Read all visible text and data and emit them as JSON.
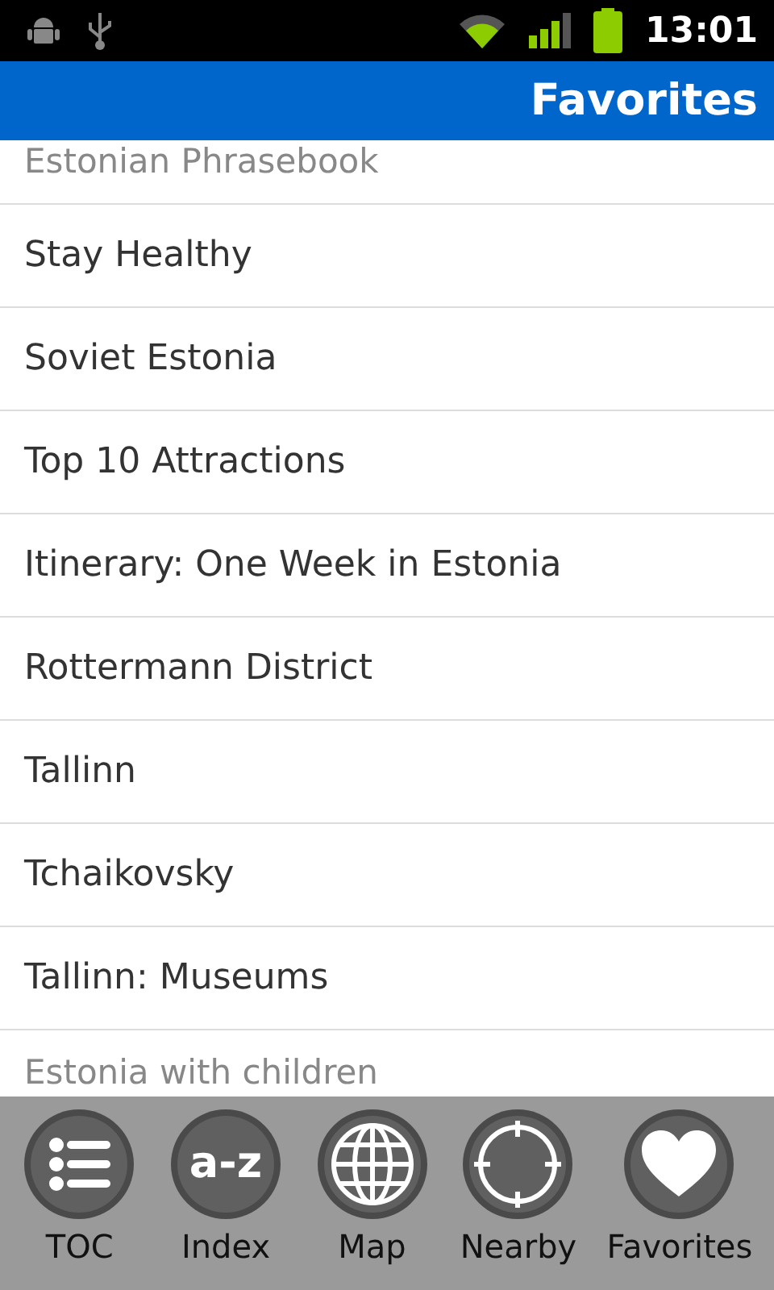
{
  "status_bar": {
    "time": "13:01"
  },
  "title": "Favorites",
  "rows": [
    {
      "label": "Estonian Phrasebook",
      "kind": "cut-top"
    },
    {
      "label": "Stay Healthy",
      "kind": "full"
    },
    {
      "label": "Soviet Estonia",
      "kind": "full"
    },
    {
      "label": "Top 10 Attractions",
      "kind": "full"
    },
    {
      "label": "Itinerary: One Week in Estonia",
      "kind": "full"
    },
    {
      "label": "Rottermann District",
      "kind": "full"
    },
    {
      "label": "Tallinn",
      "kind": "full"
    },
    {
      "label": "Tchaikovsky",
      "kind": "full"
    },
    {
      "label": "Tallinn: Museums",
      "kind": "full"
    },
    {
      "label": "Estonia with children",
      "kind": "cut-bottom"
    }
  ],
  "toolbar": [
    {
      "label": "TOC",
      "kind": "list"
    },
    {
      "label": "Index",
      "kind": "text",
      "glyph": "a-z"
    },
    {
      "label": "Map",
      "kind": "globe"
    },
    {
      "label": "Nearby",
      "kind": "crosshair"
    },
    {
      "label": "Favorites",
      "kind": "heart"
    }
  ]
}
